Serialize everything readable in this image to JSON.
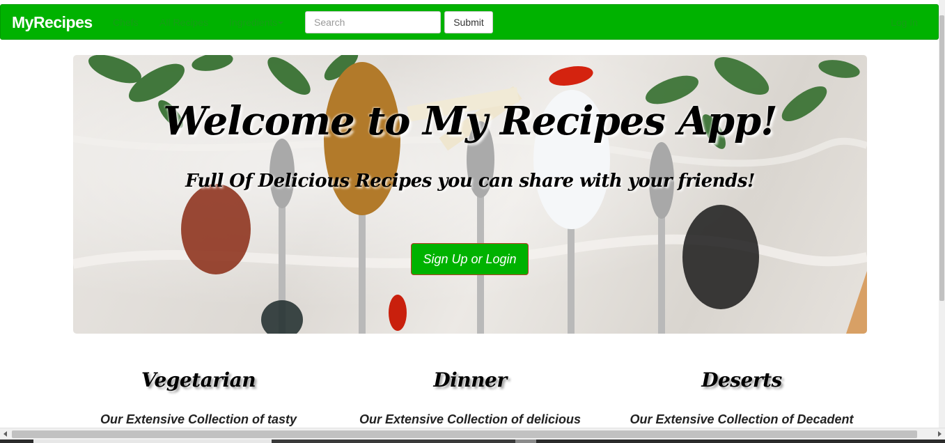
{
  "navbar": {
    "brand": "MyRecipes",
    "links": {
      "chefs": "Chefs",
      "all_recipes": "All Recipes",
      "ingredients": "Ingredients"
    },
    "search_placeholder": "Search",
    "submit_label": "Submit",
    "login_label": "Log In",
    "bg_color": "#00b200"
  },
  "hero": {
    "title": "Welcome to My Recipes App!",
    "subtitle": "Full Of Delicious Recipes you can share with your friends!",
    "cta_label": "Sign Up or Login"
  },
  "categories": [
    {
      "title": "Vegetarian",
      "description": "Our Extensive Collection of tasty"
    },
    {
      "title": "Dinner",
      "description": "Our Extensive Collection of delicious"
    },
    {
      "title": "Deserts",
      "description": "Our Extensive Collection of Decadent"
    }
  ],
  "icons": {
    "ingredients_caret": "chevron-down-icon",
    "scroll_left": "arrow-left-icon",
    "scroll_right": "arrow-right-icon"
  }
}
